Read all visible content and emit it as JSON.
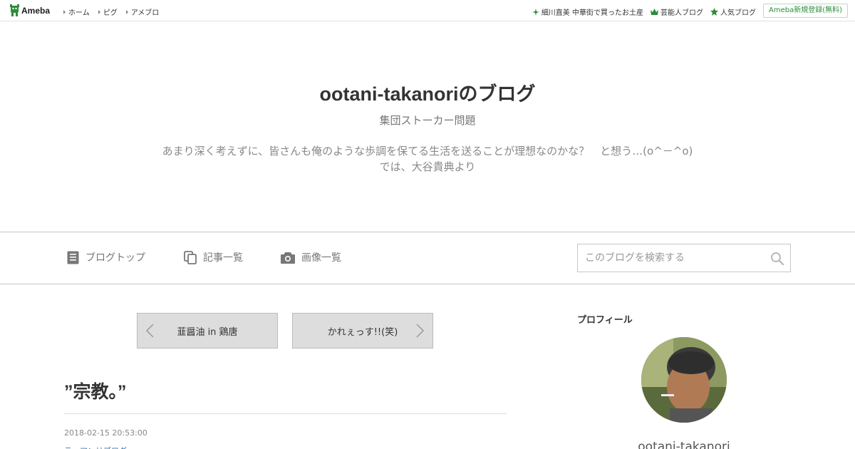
{
  "topbar": {
    "logo_text": "Ameba",
    "nav": [
      "ホーム",
      "ピグ",
      "アメブロ"
    ],
    "right_links": [
      {
        "label": "細川直美 中華街で買ったお土産",
        "icon": "sparkle-icon"
      },
      {
        "label": "芸能人ブログ",
        "icon": "crown-icon"
      },
      {
        "label": "人気ブログ",
        "icon": "star-icon"
      }
    ],
    "signup_label": "Ameba新規登録(無料)"
  },
  "header": {
    "title": "ootani-takanoriのブログ",
    "subtitle": "集団ストーカー問題",
    "description_line1": "あまり深く考えずに、皆さんも俺のような歩調を保てる生活を送ることが理想なのかな？　と想う…(o^－^o)",
    "description_line2": "では、大谷貴典より"
  },
  "nav": {
    "blog_top": "ブログトップ",
    "article_list": "記事一覧",
    "image_list": "画像一覧",
    "search_placeholder": "このブログを検索する"
  },
  "pager": {
    "prev_label": "韮醤油 in 鶏唐",
    "next_label": "かれぇっす!!(笑)"
  },
  "article": {
    "title": "”宗教。”",
    "date": "2018-02-15 20:53:00",
    "theme": "テーマ：リブログ"
  },
  "sidebar": {
    "profile_heading": "プロフィール",
    "profile_name": "ootani-takanori"
  },
  "colors": {
    "ameba_green": "#2d8c3c",
    "link_blue": "#3a7bb8",
    "border": "#c8c8c8"
  }
}
